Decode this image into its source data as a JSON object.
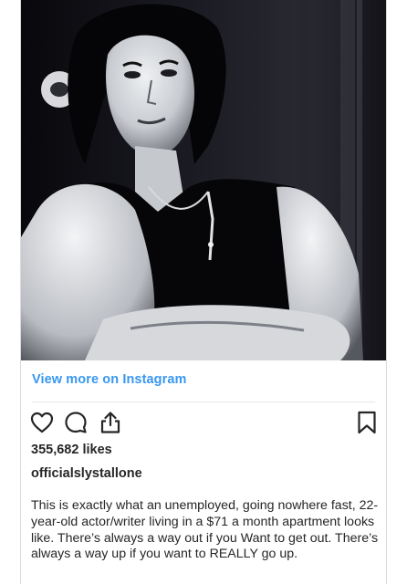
{
  "post": {
    "view_more_label": "View more on Instagram",
    "likes": "355,682 likes",
    "username": "officialslystallone",
    "caption": "This is exactly what an unemployed, going nowhere fast, 22-year-old actor/writer living in a $71 a month apartment looks like. There’s always a way out if you Want to get out. There’s always a way up if you want to REALLY go up."
  },
  "icons": {
    "like": "heart-icon",
    "comment": "comment-icon",
    "share": "share-icon",
    "save": "bookmark-icon"
  },
  "colors": {
    "link": "#3897f0",
    "text": "#262626",
    "divider": "#e6e6e6",
    "icon": "#262626"
  }
}
